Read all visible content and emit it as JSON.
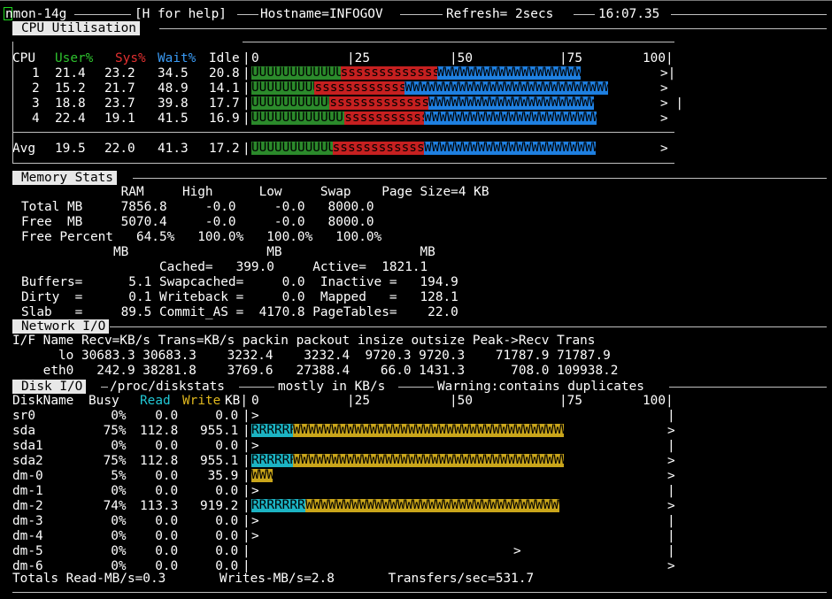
{
  "header": {
    "app": "nmon-14g",
    "help": "[H for help]",
    "hostname": "Hostname=INFOGOV",
    "refresh": "Refresh= 2secs",
    "time": "16:07.35"
  },
  "cpu": {
    "title": "CPU Utilisation",
    "headers": {
      "cpu": "CPU",
      "user": "User%",
      "sys": "Sys%",
      "wait": "Wait%",
      "idle": "Idle"
    },
    "scale": [
      "0",
      "|25",
      "|50",
      "|75",
      "100|"
    ],
    "rows": [
      {
        "id": "1",
        "user": "21.4",
        "sys": "23.2",
        "wait": "34.5",
        "idle": "20.8",
        "u": 21.4,
        "s": 23.2,
        "w": 34.5,
        "end": ">|"
      },
      {
        "id": "2",
        "user": "15.2",
        "sys": "21.7",
        "wait": "48.9",
        "idle": "14.1",
        "u": 15.2,
        "s": 21.7,
        "w": 48.9,
        "end": ">"
      },
      {
        "id": "3",
        "user": "18.8",
        "sys": "23.7",
        "wait": "39.8",
        "idle": "17.7",
        "u": 18.8,
        "s": 23.7,
        "w": 39.8,
        "end": "> |"
      },
      {
        "id": "4",
        "user": "22.4",
        "sys": "19.1",
        "wait": "41.5",
        "idle": "16.9",
        "u": 22.4,
        "s": 19.1,
        "w": 41.5,
        "end": ">"
      }
    ],
    "avg": {
      "id": "Avg",
      "user": "19.5",
      "sys": "22.0",
      "wait": "41.3",
      "idle": "17.2",
      "u": 19.5,
      "s": 22.0,
      "w": 41.3,
      "end": ">"
    }
  },
  "memory": {
    "title": "Memory Stats",
    "lines": [
      "             RAM     High      Low     Swap    Page Size=4 KB",
      "Total MB     7856.8     -0.0     -0.0   8000.0",
      "Free  MB     5070.4     -0.0     -0.0   8000.0",
      "Free Percent   64.5%   100.0%   100.0%   100.0%",
      "            MB                  MB                  MB",
      "                  Cached=   399.0     Active=  1821.1",
      "Buffers=      5.1 Swapcached=     0.0  Inactive =   194.9",
      "Dirty  =      0.1 Writeback =     0.0  Mapped   =   128.1",
      "Slab   =     89.5 Commit_AS =  4170.8 PageTables=    22.0"
    ]
  },
  "network": {
    "title": "Network I/O",
    "lines": [
      "I/F Name Recv=KB/s Trans=KB/s packin packout insize outsize Peak->Recv Trans",
      "      lo 30683.3 30683.3    3232.4    3232.4  9720.3 9720.3    71787.9 71787.9",
      "    eth0   242.9 38281.8    3769.6   27388.4    66.0 1431.3      708.0 109938.2"
    ]
  },
  "disk": {
    "title": "Disk I/O",
    "path": "/proc/diskstats",
    "units": "mostly in KB/s",
    "warning": "Warning:contains duplicates",
    "headers": {
      "name": "DiskName",
      "busy": "Busy",
      "read": "Read",
      "write": "Write",
      "kb": "KB|"
    },
    "scale": [
      "0",
      "|25",
      "|50",
      "|75",
      "100|"
    ],
    "rows": [
      {
        "name": "sr0",
        "busy": "0%",
        "read": "0.0",
        "write": "0.0",
        "r": 0,
        "w": 0,
        "marker": ">",
        "end": "|"
      },
      {
        "name": "sda",
        "busy": "75%",
        "read": "112.8",
        "write": "955.1",
        "r": 10,
        "w": 65,
        "marker": "",
        "end": ">"
      },
      {
        "name": "sda1",
        "busy": "0%",
        "read": "0.0",
        "write": "0.0",
        "r": 0,
        "w": 0,
        "marker": ">",
        "end": "|"
      },
      {
        "name": "sda2",
        "busy": "75%",
        "read": "112.8",
        "write": "955.1",
        "r": 10,
        "w": 65,
        "marker": "",
        "end": ">"
      },
      {
        "name": "dm-0",
        "busy": "5%",
        "read": "0.0",
        "write": "35.9",
        "r": 0,
        "w": 5,
        "marker": "",
        "end": ">"
      },
      {
        "name": "dm-1",
        "busy": "0%",
        "read": "0.0",
        "write": "0.0",
        "r": 0,
        "w": 0,
        "marker": ">",
        "end": "|"
      },
      {
        "name": "dm-2",
        "busy": "74%",
        "read": "113.3",
        "write": "919.2",
        "r": 13,
        "w": 61,
        "marker": "",
        "end": ">"
      },
      {
        "name": "dm-3",
        "busy": "0%",
        "read": "0.0",
        "write": "0.0",
        "r": 0,
        "w": 0,
        "marker": ">",
        "end": "|"
      },
      {
        "name": "dm-4",
        "busy": "0%",
        "read": "0.0",
        "write": "0.0",
        "r": 0,
        "w": 0,
        "marker": ">",
        "end": "|"
      },
      {
        "name": "dm-5",
        "busy": "0%",
        "read": "0.0",
        "write": "0.0",
        "r": 0,
        "w": 0,
        "marker": "",
        "end": "|",
        "mid": ">"
      },
      {
        "name": "dm-6",
        "busy": "0%",
        "read": "0.0",
        "write": "0.0",
        "r": 0,
        "w": 0,
        "marker": "",
        "end": ">"
      }
    ],
    "totals": "Totals Read-MB/s=0.3       Writes-MB/s=2.8       Transfers/sec=531.7"
  },
  "colors": {
    "user": "#2b8a2b",
    "sys": "#c62020",
    "wait": "#1e7fe0",
    "read": "#1cb3c3",
    "write": "#c9a51a",
    "background": "#000000"
  }
}
